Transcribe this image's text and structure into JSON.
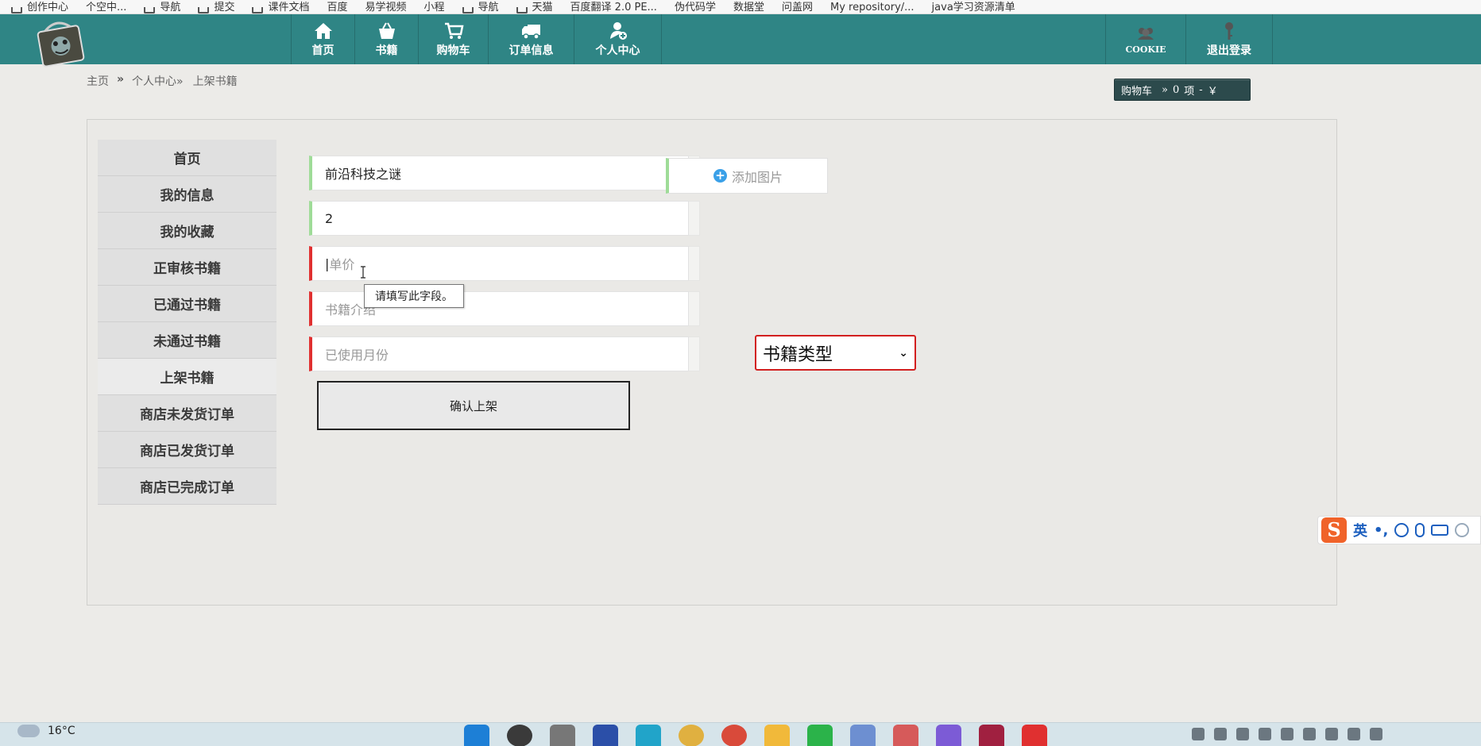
{
  "bookmarks": [
    "创作中心",
    "个空中...",
    "导航",
    "提交",
    "课件文档",
    "百度",
    "易学视频",
    "小程",
    "导航",
    "天猫",
    "百度翻译 2.0 PE...",
    "伪代码学",
    "数据堂",
    "问盖网",
    "My repository/...",
    "java学习资源清单"
  ],
  "nav": {
    "left": [
      {
        "label": "首页",
        "icon": "home-icon"
      },
      {
        "label": "书籍",
        "icon": "basket-icon"
      },
      {
        "label": "购物车",
        "icon": "cart-icon"
      },
      {
        "label": "订单信息",
        "icon": "truck-icon"
      },
      {
        "label": "个人中心",
        "icon": "user-add-icon"
      }
    ],
    "right": [
      {
        "label": "COOKIE",
        "icon": "users-icon"
      },
      {
        "label": "退出登录",
        "icon": "key-icon"
      }
    ]
  },
  "breadcrumb": {
    "home": "主页",
    "sep1": "»",
    "center": "个人中心»",
    "current": "上架书籍"
  },
  "cart_summary": {
    "label": "购物车",
    "arrows": "»",
    "count": "0",
    "unit": "项",
    "dash": "-",
    "currency": "￥"
  },
  "sidebar": [
    "首页",
    "我的信息",
    "我的收藏",
    "正审核书籍",
    "已通过书籍",
    "未通过书籍",
    "上架书籍",
    "商店未发货订单",
    "商店已发货订单",
    "商店已完成订单"
  ],
  "sidebar_active": "上架书籍",
  "form": {
    "title_value": "前沿科技之谜",
    "quantity_value": "2",
    "price_placeholder": "单价",
    "intro_placeholder": "书籍介绍",
    "months_placeholder": "已使用月份",
    "add_image_label": "添加图片",
    "type_select_value": "书籍类型",
    "submit_label": "确认上架",
    "validation_tooltip": "请填写此字段。"
  },
  "ime": {
    "mode": "英",
    "punct": "•,"
  },
  "taskbar": {
    "weather_temp": "16°C"
  },
  "colors": {
    "nav_bg": "#2f8585",
    "valid_border": "#9fdc98",
    "invalid_border": "#e03030",
    "select_border": "#d21f1f"
  }
}
